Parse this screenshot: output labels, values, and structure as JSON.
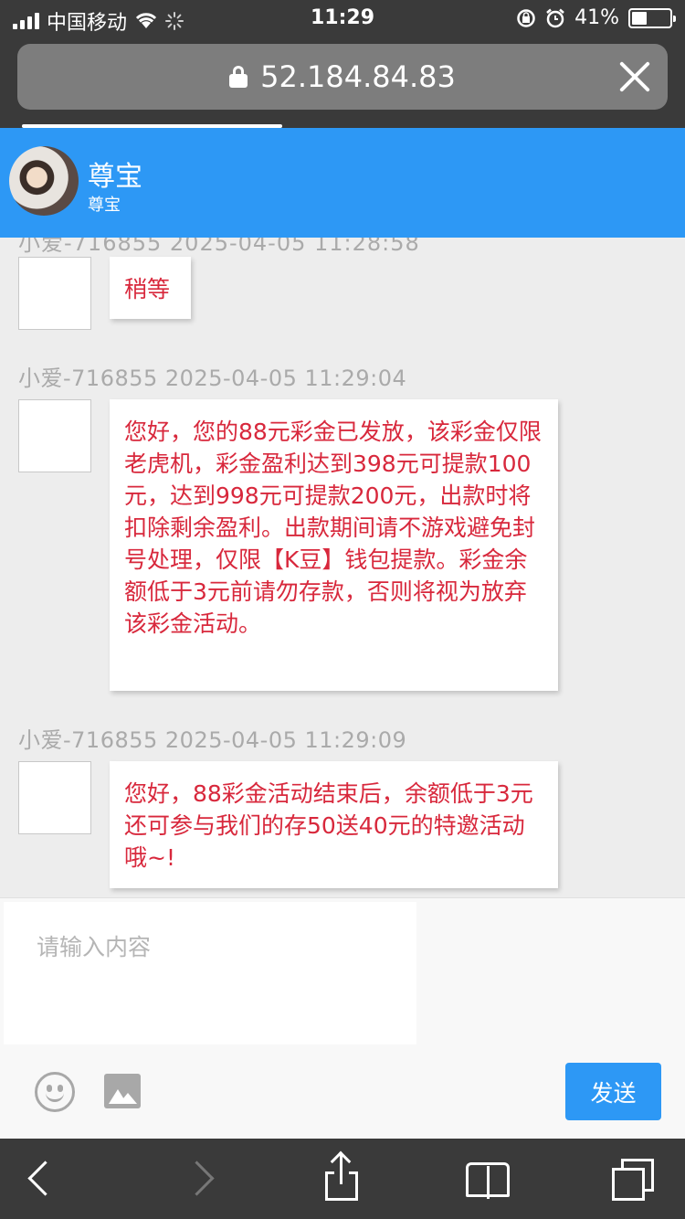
{
  "status_bar": {
    "carrier": "中国移动",
    "time": "11:29",
    "battery_percent": "41%",
    "battery_level": 0.41
  },
  "browser": {
    "url": "52.184.84.83",
    "load_progress": 0.38
  },
  "chat_header": {
    "name": "尊宝",
    "subtitle": "尊宝"
  },
  "messages": [
    {
      "meta": "小爱-716855 2025-04-05 11:28:58",
      "text": "稍等"
    },
    {
      "meta": "小爱-716855 2025-04-05 11:29:04",
      "text": "您好，您的88元彩金已发放，该彩金仅限老虎机，彩金盈利达到398元可提款100元，达到998元可提款200元，出款时将扣除剩余盈利。出款期间请不游戏避免封号处理，仅限【K豆】钱包提款。彩金余额低于3元前请勿存款，否则将视为放弃该彩金活动。"
    },
    {
      "meta": "小爱-716855 2025-04-05 11:29:09",
      "text": "您好，88彩金活动结束后，余额低于3元还可参与我们的存50送40元的特邀活动哦~!"
    }
  ],
  "composer": {
    "placeholder": "请输入内容",
    "send_label": "发送"
  },
  "colors": {
    "accent": "#2d98f5",
    "message_text": "#d8283c",
    "chrome": "#3a3a3a"
  },
  "icons": [
    "signal-icon",
    "wifi-icon",
    "loading-icon",
    "orientation-lock-icon",
    "alarm-icon",
    "battery-icon",
    "lock-icon",
    "close-icon",
    "emoji-icon",
    "image-icon",
    "back-icon",
    "forward-icon",
    "share-icon",
    "bookmarks-icon",
    "tabs-icon"
  ]
}
